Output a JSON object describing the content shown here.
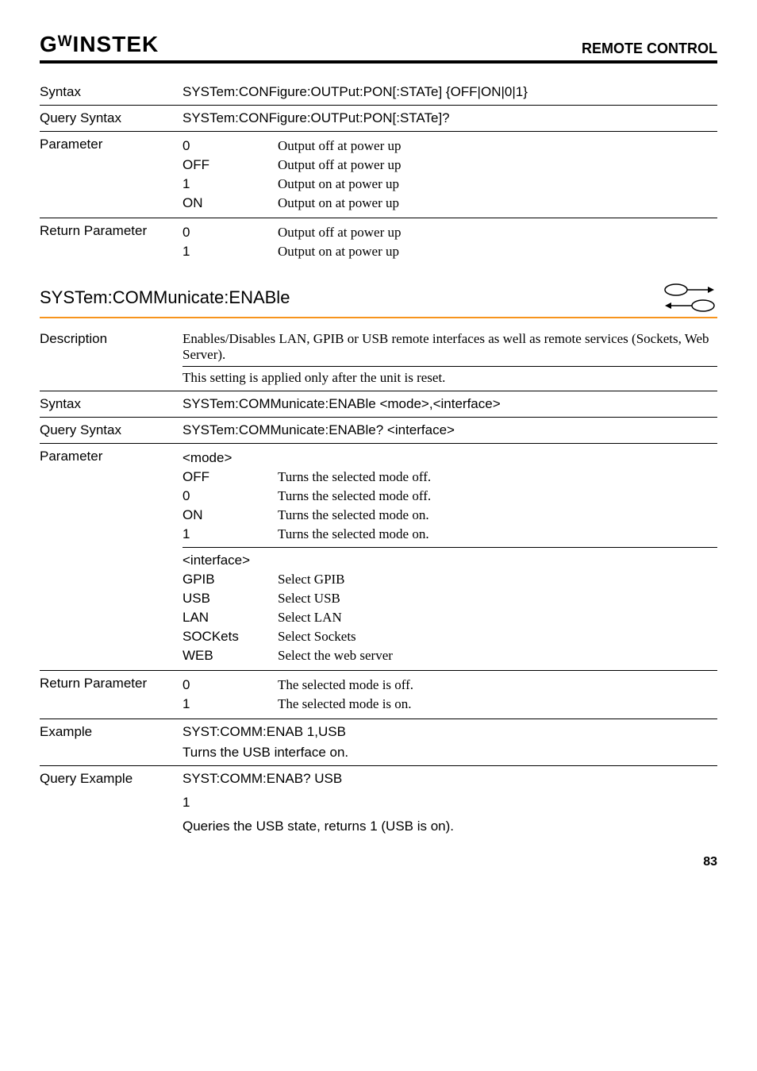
{
  "header": {
    "logo": "GᵂINSTEK",
    "title": "REMOTE CONTROL"
  },
  "block1": {
    "syntax_label": "Syntax",
    "syntax_val": "SYSTem:CONFigure:OUTPut:PON[:STATe] {OFF|ON|0|1}",
    "qsyntax_label": "Query Syntax",
    "qsyntax_val": "SYSTem:CONFigure:OUTPut:PON[:STATe]?",
    "param_label": "Parameter",
    "params": [
      {
        "k": "0",
        "v": "Output off at power up"
      },
      {
        "k": "OFF",
        "v": "Output off at power up"
      },
      {
        "k": "1",
        "v": "Output on at power up"
      },
      {
        "k": "ON",
        "v": "Output on at power up"
      }
    ],
    "retparam_label": "Return Parameter",
    "retparams": [
      {
        "k": "0",
        "v": "Output off at power up"
      },
      {
        "k": "1",
        "v": "Output on at power up"
      }
    ]
  },
  "section": {
    "title": "SYSTem:COMMunicate:ENABle"
  },
  "block2": {
    "desc_label": "Description",
    "desc_val": "Enables/Disables LAN, GPIB or USB remote interfaces as well as remote services (Sockets, Web Server).",
    "desc_val2": "This setting is applied only after the unit is reset.",
    "syntax_label": "Syntax",
    "syntax_val": "SYSTem:COMMunicate:ENABle <mode>,<interface>",
    "qsyntax_label": "Query Syntax",
    "qsyntax_val": "SYSTem:COMMunicate:ENABle? <interface>",
    "param_label": "Parameter",
    "mode_head": "<mode>",
    "modes": [
      {
        "k": "OFF",
        "v": "Turns the selected mode off."
      },
      {
        "k": "0",
        "v": "Turns the selected mode off."
      },
      {
        "k": "ON",
        "v": "Turns the selected mode on."
      },
      {
        "k": "1",
        "v": "Turns the selected mode on."
      }
    ],
    "iface_head": "<interface>",
    "ifaces": [
      {
        "k": "GPIB",
        "v": "Select GPIB"
      },
      {
        "k": "USB",
        "v": "Select USB"
      },
      {
        "k": "LAN",
        "v": "Select LAN"
      },
      {
        "k": "SOCKets",
        "v": "Select Sockets"
      },
      {
        "k": "WEB",
        "v": "Select the web server"
      }
    ],
    "retparam_label": "Return Parameter",
    "retparams": [
      {
        "k": "0",
        "v": "The selected mode is off."
      },
      {
        "k": "1",
        "v": "The selected mode is on."
      }
    ],
    "example_label": "Example",
    "example_val": "SYST:COMM:ENAB 1,USB",
    "example_desc": "Turns the USB interface on.",
    "qexample_label": "Query Example",
    "qexample_val": "SYST:COMM:ENAB? USB",
    "qexample_ret": "1",
    "qexample_desc": "Queries the USB state, returns 1 (USB is on)."
  },
  "page": "83"
}
